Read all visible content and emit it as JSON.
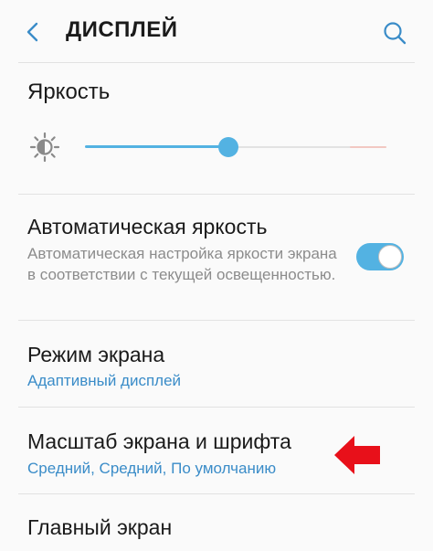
{
  "header": {
    "title": "ДИСПЛЕЙ",
    "back_icon": "chevron-left-icon",
    "search_icon": "search-icon"
  },
  "brightness": {
    "title": "Яркость",
    "icon": "sun-icon",
    "level": 0.475
  },
  "auto_brightness": {
    "title": "Автоматическая яркость",
    "description": "Автоматическая настройка яркости экрана в соответствии с текущей освещенностью.",
    "enabled": true
  },
  "screen_mode": {
    "title": "Режим экрана",
    "value": "Адаптивный дисплей"
  },
  "screen_zoom": {
    "title": "Масштаб экрана и шрифта",
    "value": "Средний, Средний, По умолчанию"
  },
  "home_screen": {
    "title": "Главный экран"
  },
  "annotation": {
    "icon": "red-arrow-icon",
    "color": "#e8101a"
  },
  "colors": {
    "accent": "#53b2e2",
    "link": "#3a8cc8"
  }
}
